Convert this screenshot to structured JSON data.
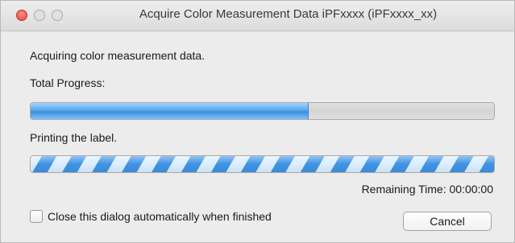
{
  "window": {
    "title": "Acquire Color Measurement Data iPFxxxx (iPFxxxx_xx)"
  },
  "dialog": {
    "status_text": "Acquiring color measurement data.",
    "total_progress_label": "Total Progress:",
    "total_progress_fraction": 0.6,
    "step_label": "Printing the label.",
    "step_progress": "indeterminate",
    "remaining_time_label": "Remaining Time: 00:00:00",
    "auto_close_label": "Close this dialog automatically when finished",
    "auto_close_checked": false,
    "cancel_label": "Cancel"
  },
  "colors": {
    "close_button": "#ff5f57",
    "progress_blue": "#3b8fe0"
  }
}
